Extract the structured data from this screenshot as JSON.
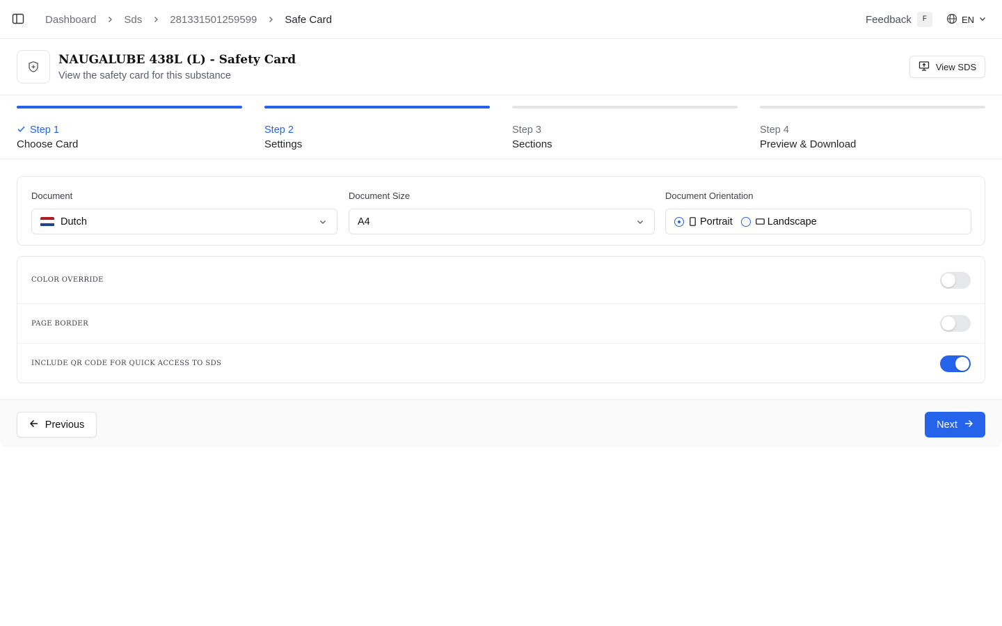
{
  "breadcrumb": {
    "items": [
      "Dashboard",
      "Sds",
      "281331501259599"
    ],
    "current": "Safe Card"
  },
  "topbar": {
    "feedback_label": "Feedback",
    "feedback_shortcut": "F",
    "language": "EN"
  },
  "header": {
    "title": "NAUGALUBE 438L (L) - Safety Card",
    "subtitle": "View the safety card for this substance",
    "view_sds_label": "View SDS"
  },
  "steps": [
    {
      "number": "Step 1",
      "name": "Choose Card",
      "state": "completed"
    },
    {
      "number": "Step 2",
      "name": "Settings",
      "state": "current"
    },
    {
      "number": "Step 3",
      "name": "Sections",
      "state": "upcoming"
    },
    {
      "number": "Step 4",
      "name": "Preview & Download",
      "state": "upcoming"
    }
  ],
  "document_settings": {
    "document_label": "Document",
    "document_value": "Dutch",
    "size_label": "Document Size",
    "size_value": "A4",
    "orientation_label": "Document Orientation",
    "orientation_options": [
      "Portrait",
      "Landscape"
    ],
    "orientation_selected": "Portrait"
  },
  "toggles": [
    {
      "label": "Color override",
      "on": false
    },
    {
      "label": "Page border",
      "on": false
    },
    {
      "label": "Include QR code for quick access to SDS",
      "on": true
    }
  ],
  "footer": {
    "previous_label": "Previous",
    "next_label": "Next"
  },
  "colors": {
    "accent": "#2563eb",
    "border": "#e8e8e8",
    "muted_text": "#6b6f76"
  }
}
